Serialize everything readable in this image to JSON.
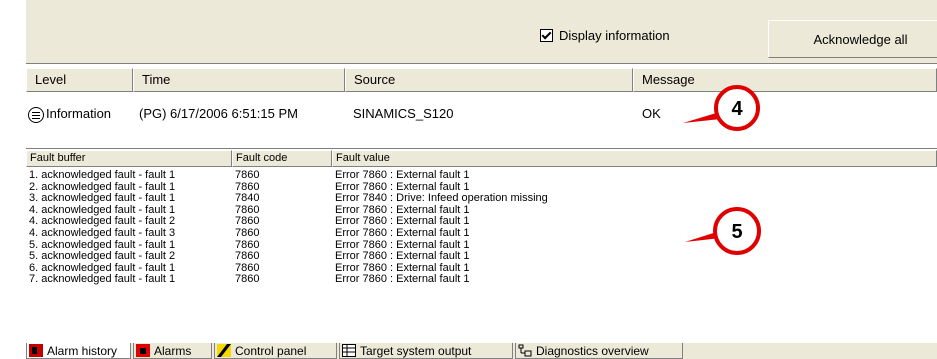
{
  "toolbar": {
    "display_info_label": "Display information",
    "display_info_checked": true,
    "acknowledge_all_label": "Acknowledge all"
  },
  "message_grid": {
    "columns": [
      "Level",
      "Time",
      "Source",
      "Message"
    ],
    "row": {
      "level": "Information",
      "time": "(PG) 6/17/2006 6:51:15 PM",
      "source": "SINAMICS_S120",
      "message": "OK"
    }
  },
  "fault_grid": {
    "columns": [
      "Fault buffer",
      "Fault code",
      "Fault value"
    ],
    "rows": [
      [
        "1. acknowledged fault - fault 1",
        "7860",
        "Error 7860 : External fault 1"
      ],
      [
        "2. acknowledged fault - fault 1",
        "7860",
        "Error 7860 : External fault 1"
      ],
      [
        "3. acknowledged fault - fault 1",
        "7840",
        "Error 7840 : Drive: Infeed operation missing"
      ],
      [
        "4. acknowledged fault - fault 1",
        "7860",
        "Error 7860 : External fault 1"
      ],
      [
        "4. acknowledged fault - fault 2",
        "7860",
        "Error 7860 : External fault 1"
      ],
      [
        "4. acknowledged fault - fault 3",
        "7860",
        "Error 7860 : External fault 1"
      ],
      [
        "5. acknowledged fault - fault 1",
        "7860",
        "Error 7860 : External fault 1"
      ],
      [
        "5. acknowledged fault - fault 2",
        "7860",
        "Error 7860 : External fault 1"
      ],
      [
        "6. acknowledged fault - fault 1",
        "7860",
        "Error 7860 : External fault 1"
      ],
      [
        "7. acknowledged fault - fault 1",
        "7860",
        "Error 7860 : External fault 1"
      ]
    ]
  },
  "tabs": [
    {
      "label": "Alarm history",
      "icon": "alarm-history-icon",
      "active": true
    },
    {
      "label": "Alarms",
      "icon": "alarms-icon",
      "active": false
    },
    {
      "label": "Control panel",
      "icon": "control-panel-icon",
      "active": false
    },
    {
      "label": "Target system output",
      "icon": "table-icon",
      "active": false
    },
    {
      "label": "Diagnostics overview",
      "icon": "diagnostics-icon",
      "active": false
    }
  ],
  "callouts": [
    "4",
    "5"
  ],
  "colors": {
    "callout_ring": "#e00000",
    "callout_fill": "#ffffff",
    "panel_bg": "#ece9d8"
  }
}
